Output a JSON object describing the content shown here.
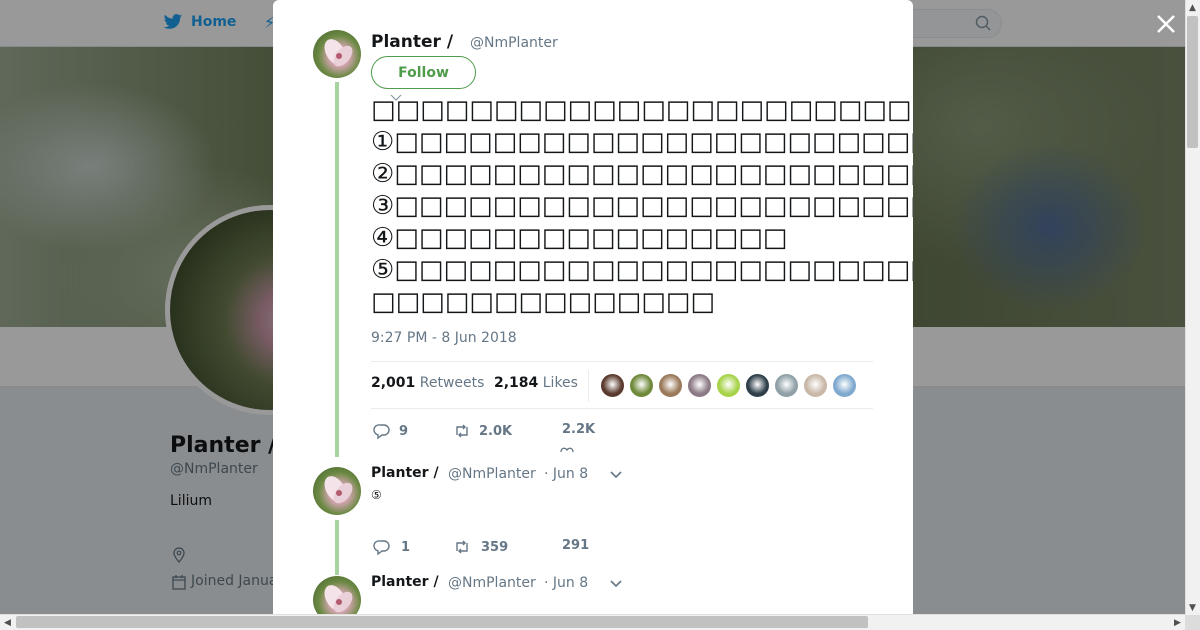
{
  "nav": {
    "home_label": "Home"
  },
  "profile": {
    "name": "Planter /",
    "handle": "@NmPlanter",
    "bio": "Lilium",
    "joined": "Joined Janua"
  },
  "tweet": {
    "author_name": "Planter /",
    "author_handle": "@NmPlanter",
    "follow_label": "Follow",
    "text": "□□□□□□□□□□□□□□□□□□□□□□□□□□□□□□\n①□□□□□□□□□□□□□□□□□□□□□□□□□\n②□□□□□□□□□□□□□□□□□□□□□□□□\n③□□□□□□□□□□□□□□□□□□□□□□□□□□□□□□□□\n④□□□□□□□□□□□□□□□□\n⑤□□□□□□□□□□□□□□□□□□□□□□□□□□□□□□□□□□□\n□□□□□□□□□□□□□□",
    "timestamp": "9:27 PM - 8 Jun 2018",
    "retweets_count": "2,001",
    "retweets_label": "Retweets",
    "likes_count": "2,184",
    "likes_label": "Likes",
    "reply_count": "9",
    "retweet_action_count": "2.0K",
    "like_action_count": "2.2K",
    "liker_colors": [
      "#5a3a2e",
      "#6f8a3b",
      "#9a7a5a",
      "#8c7a86",
      "#a7d34a",
      "#2f3f4a",
      "#8fa0a6",
      "#c9b8a8",
      "#7fa9cf"
    ]
  },
  "replies": [
    {
      "author_name": "Planter /",
      "author_handle": "@NmPlanter",
      "date": "· Jun 8",
      "text": "⑤",
      "reply_count": "1",
      "retweet_count": "359",
      "like_count": "291"
    },
    {
      "author_name": "Planter /",
      "author_handle": "@NmPlanter",
      "date": "· Jun 8"
    }
  ]
}
